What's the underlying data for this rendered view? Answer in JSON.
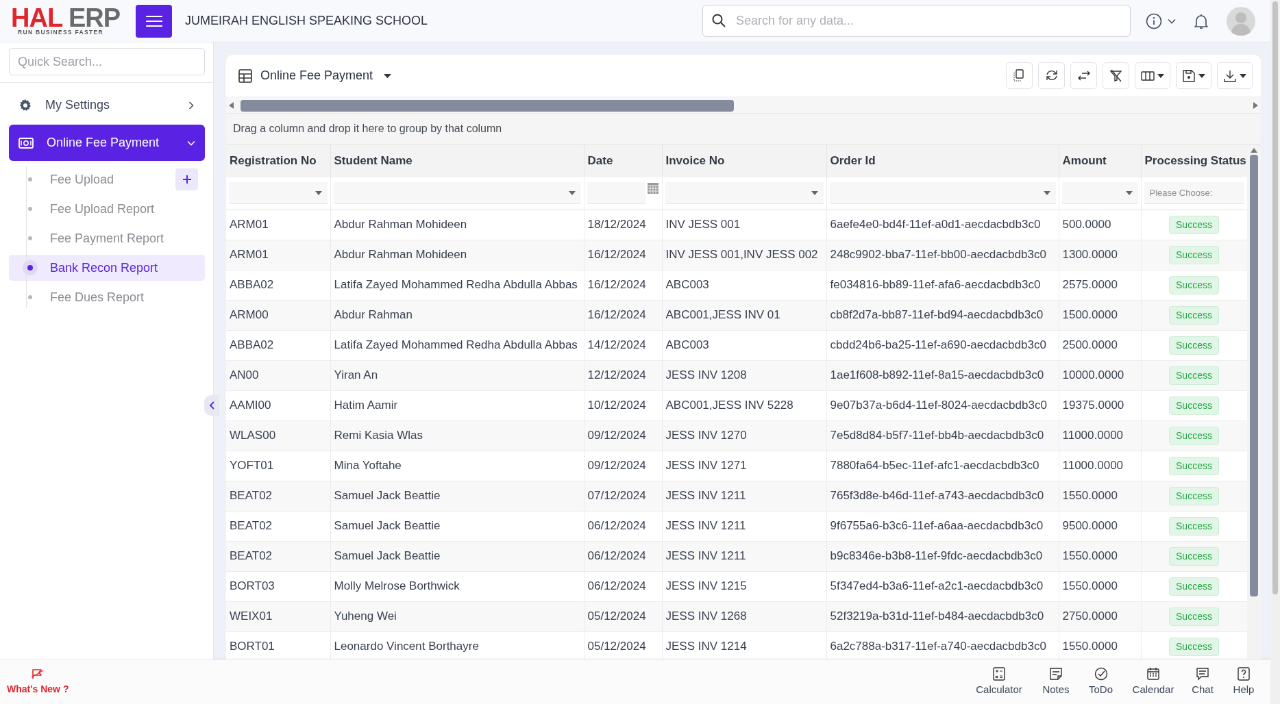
{
  "header": {
    "logo": {
      "primary": "HAL",
      "secondary": "ERP",
      "tagline": "RUN BUSINESS FASTER"
    },
    "organization": "JUMEIRAH ENGLISH SPEAKING SCHOOL",
    "search": {
      "placeholder": "Search for any data..."
    }
  },
  "sidebar": {
    "quick_search": {
      "placeholder": "Quick Search..."
    },
    "items": [
      {
        "label": "My Settings",
        "kind": "settings",
        "selected": false,
        "expanded": false
      },
      {
        "label": "Online Fee Payment",
        "kind": "payment",
        "selected": true,
        "expanded": true,
        "children": [
          {
            "label": "Fee Upload",
            "selected": false,
            "add_button": true
          },
          {
            "label": "Fee Upload Report",
            "selected": false,
            "add_button": false
          },
          {
            "label": "Fee Payment Report",
            "selected": false,
            "add_button": false
          },
          {
            "label": "Bank Recon Report",
            "selected": true,
            "add_button": false
          },
          {
            "label": "Fee Dues Report",
            "selected": false,
            "add_button": false
          }
        ]
      }
    ]
  },
  "grid": {
    "title": "Online Fee Payment",
    "group_hint": "Drag a column and drop it here to group by that column",
    "columns": [
      {
        "label": "Registration No",
        "kind": "text",
        "filter": {
          "kind": "dropdown"
        }
      },
      {
        "label": "Student Name",
        "kind": "text",
        "filter": {
          "kind": "dropdown"
        }
      },
      {
        "label": "Date",
        "kind": "text",
        "filter": {
          "kind": "date"
        }
      },
      {
        "label": "Invoice No",
        "kind": "text",
        "filter": {
          "kind": "dropdown"
        }
      },
      {
        "label": "Order Id",
        "kind": "text",
        "filter": {
          "kind": "dropdown"
        }
      },
      {
        "label": "Amount",
        "kind": "text",
        "filter": {
          "kind": "dropdown"
        }
      },
      {
        "label": "Processing Status",
        "kind": "status",
        "filter": {
          "kind": "select",
          "placeholder": "Please Choose:"
        }
      }
    ],
    "rows": [
      [
        "ARM01",
        "Abdur Rahman Mohideen",
        "18/12/2024",
        "INV JESS 001",
        "6aefe4e0-bd4f-11ef-a0d1-aecdacbdb3c0",
        "500.0000",
        "Success"
      ],
      [
        "ARM01",
        "Abdur Rahman Mohideen",
        "16/12/2024",
        "INV JESS 001,INV JESS 002",
        "248c9902-bba7-11ef-bb00-aecdacbdb3c0",
        "1300.0000",
        "Success"
      ],
      [
        "ABBA02",
        "Latifa Zayed Mohammed Redha Abdulla Abbas",
        "16/12/2024",
        "ABC003",
        "fe034816-bb89-11ef-afa6-aecdacbdb3c0",
        "2575.0000",
        "Success"
      ],
      [
        "ARM00",
        "Abdur Rahman",
        "16/12/2024",
        "ABC001,JESS INV 01",
        "cb8f2d7a-bb87-11ef-bd94-aecdacbdb3c0",
        "1500.0000",
        "Success"
      ],
      [
        "ABBA02",
        "Latifa Zayed Mohammed Redha Abdulla Abbas",
        "14/12/2024",
        "ABC003",
        "cbdd24b6-ba25-11ef-a690-aecdacbdb3c0",
        "2500.0000",
        "Success"
      ],
      [
        "AN00",
        "Yiran An",
        "12/12/2024",
        "JESS INV 1208",
        "1ae1f608-b892-11ef-8a15-aecdacbdb3c0",
        "10000.0000",
        "Success"
      ],
      [
        "AAMI00",
        "Hatim Aamir",
        "10/12/2024",
        "ABC001,JESS INV 5228",
        "9e07b37a-b6d4-11ef-8024-aecdacbdb3c0",
        "19375.0000",
        "Success"
      ],
      [
        "WLAS00",
        "Remi Kasia Wlas",
        "09/12/2024",
        "JESS INV 1270",
        "7e5d8d84-b5f7-11ef-bb4b-aecdacbdb3c0",
        "11000.0000",
        "Success"
      ],
      [
        "YOFT01",
        "Mina Yoftahe",
        "09/12/2024",
        "JESS INV 1271",
        "7880fa64-b5ec-11ef-afc1-aecdacbdb3c0",
        "11000.0000",
        "Success"
      ],
      [
        "BEAT02",
        "Samuel Jack Beattie",
        "07/12/2024",
        "JESS INV 1211",
        "765f3d8e-b46d-11ef-a743-aecdacbdb3c0",
        "1550.0000",
        "Success"
      ],
      [
        "BEAT02",
        "Samuel Jack Beattie",
        "06/12/2024",
        "JESS INV 1211",
        "9f6755a6-b3c6-11ef-a6aa-aecdacbdb3c0",
        "9500.0000",
        "Success"
      ],
      [
        "BEAT02",
        "Samuel Jack Beattie",
        "06/12/2024",
        "JESS INV 1211",
        "b9c8346e-b3b8-11ef-9fdc-aecdacbdb3c0",
        "1550.0000",
        "Success"
      ],
      [
        "BORT03",
        "Molly Melrose Borthwick",
        "06/12/2024",
        "JESS INV 1215",
        "5f347ed4-b3a6-11ef-a2c1-aecdacbdb3c0",
        "1550.0000",
        "Success"
      ],
      [
        "WEIX01",
        "Yuheng Wei",
        "05/12/2024",
        "JESS INV 1268",
        "52f3219a-b31d-11ef-b484-aecdacbdb3c0",
        "2750.0000",
        "Success"
      ],
      [
        "BORT01",
        "Leonardo Vincent Borthayre",
        "05/12/2024",
        "JESS INV 1214",
        "6a2c788a-b317-11ef-a740-aecdacbdb3c0",
        "1550.0000",
        "Success"
      ]
    ]
  },
  "footer": {
    "whats_new": "What's New ?",
    "tools": [
      {
        "label": "Calculator"
      },
      {
        "label": "Notes"
      },
      {
        "label": "ToDo"
      },
      {
        "label": "Calendar"
      },
      {
        "label": "Chat"
      },
      {
        "label": "Help"
      }
    ]
  }
}
